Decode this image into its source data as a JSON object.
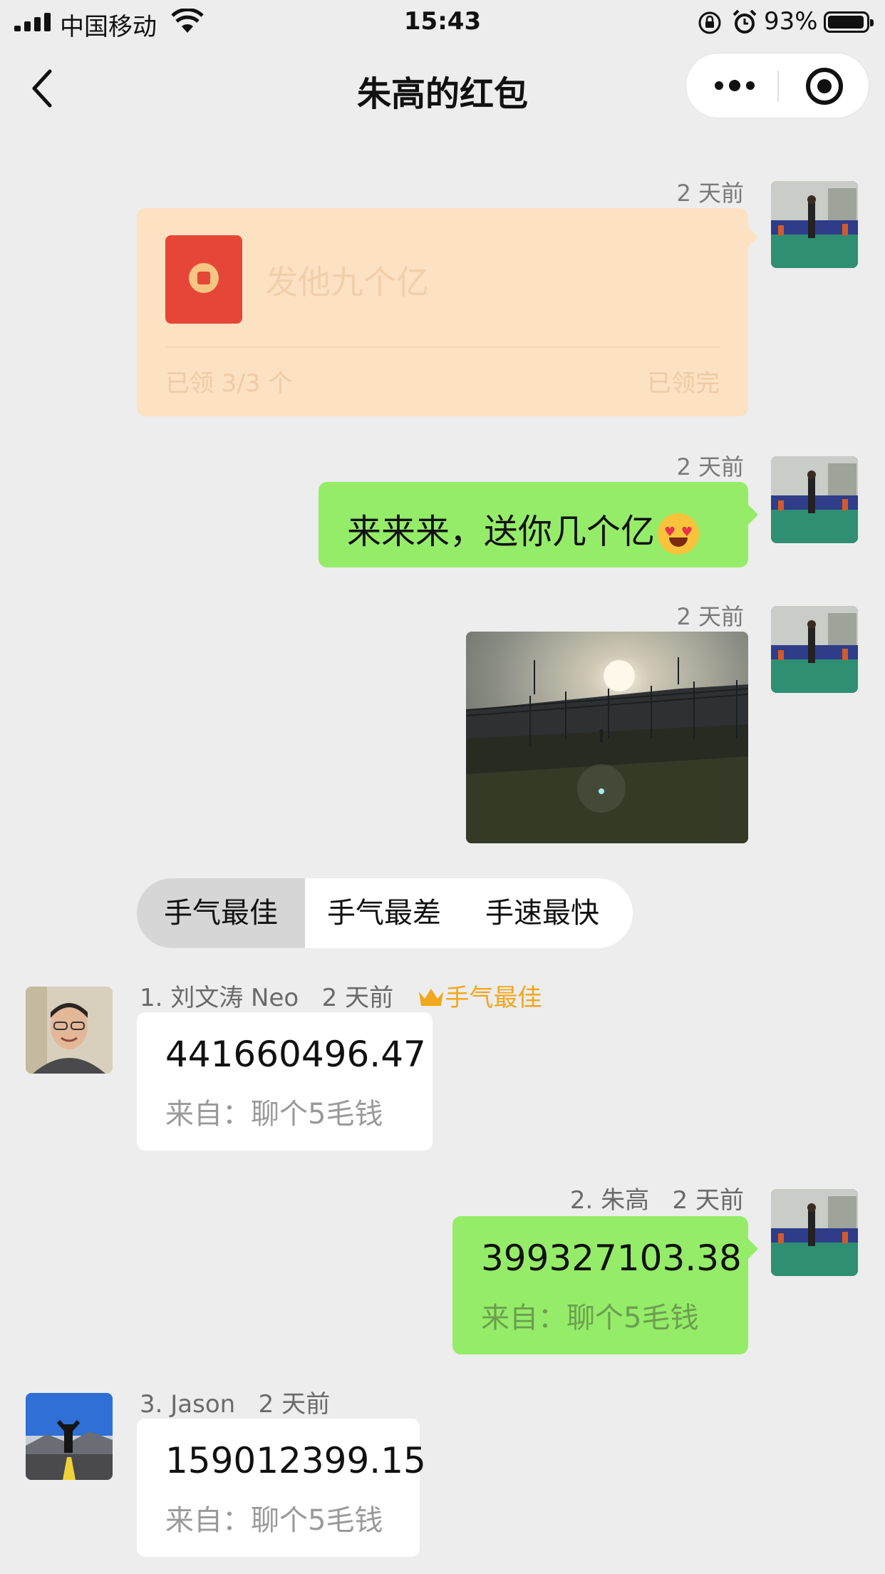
{
  "status_bar": {
    "carrier": "中国移动",
    "time": "15:43",
    "battery_percent": "93%",
    "battery_level": 0.93
  },
  "nav": {
    "title": "朱高的红包"
  },
  "messages": [
    {
      "type": "red_packet",
      "timestamp": "2 天前",
      "text": "发他九个亿",
      "claimed": "已领 3/3 个",
      "status": "已领完"
    },
    {
      "type": "text",
      "timestamp": "2 天前",
      "text": "来来来，送你几个亿"
    },
    {
      "type": "image",
      "timestamp": "2 天前"
    }
  ],
  "tabs": [
    {
      "label": "手气最佳",
      "active": true
    },
    {
      "label": "手气最差",
      "active": false
    },
    {
      "label": "手速最快",
      "active": false
    }
  ],
  "recipients": [
    {
      "rank_name": "1. 刘文涛 Neo",
      "timestamp": "2 天前",
      "badge": "手气最佳",
      "amount": "441660496.47",
      "from": "来自：聊个5毛钱"
    },
    {
      "rank_name": "2. 朱高",
      "timestamp": "2 天前",
      "amount": "399327103.38",
      "from": "来自：聊个5毛钱"
    },
    {
      "rank_name": "3. Jason",
      "timestamp": "2 天前",
      "amount": "159012399.15",
      "from": "来自：聊个5毛钱"
    }
  ],
  "colors": {
    "background": "#ededed",
    "self_bubble": "#95ec69",
    "packet_card": "#fce1c3",
    "packet_envelope": "#e64637",
    "best_badge": "#f2a71c"
  }
}
